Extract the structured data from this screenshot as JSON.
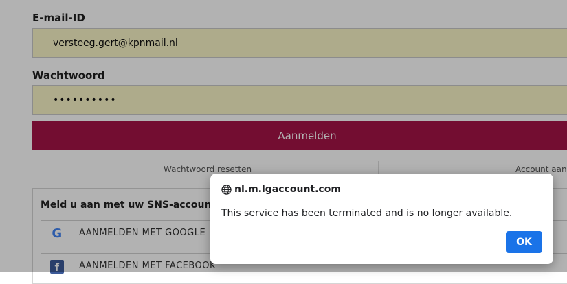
{
  "login": {
    "email_label": "E-mail-ID",
    "email_value": "versteeg.gert@kpnmail.nl",
    "password_label": "Wachtwoord",
    "password_value": "••••••••••",
    "login_button": "Aanmelden",
    "reset_link": "Wachtwoord resetten",
    "account_link": "Account aanm"
  },
  "sns": {
    "title": "Meld u aan met uw SNS-accounts.",
    "google_label": "AANMELDEN MET GOOGLE",
    "google_icon": "google-icon",
    "facebook_label": "AANMELDEN MET FACEBOOK",
    "facebook_icon": "facebook-icon"
  },
  "dialog": {
    "icon": "globe-icon",
    "title": "nl.m.lgaccount.com",
    "message": "This service has been terminated and is no longer available.",
    "ok_label": "OK"
  },
  "colors": {
    "accent": "#a51447",
    "field_bg": "#faf5c8",
    "ok_button": "#1a73e8"
  }
}
